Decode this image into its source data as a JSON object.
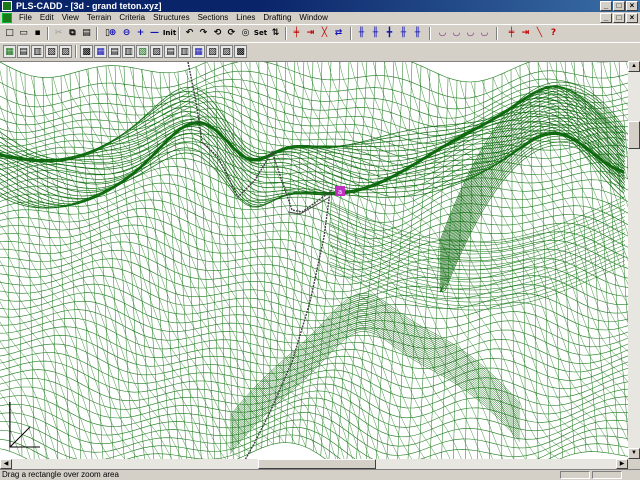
{
  "window": {
    "title": "PLS-CADD - [3d - grand teton.xyz]",
    "minimize_glyph": "_",
    "maximize_glyph": "□",
    "close_glyph": "×"
  },
  "menu": {
    "items": [
      {
        "id": "file",
        "label": "File"
      },
      {
        "id": "edit",
        "label": "Edit"
      },
      {
        "id": "view",
        "label": "View"
      },
      {
        "id": "terrain",
        "label": "Terrain"
      },
      {
        "id": "criteria",
        "label": "Criteria"
      },
      {
        "id": "structures",
        "label": "Structures"
      },
      {
        "id": "sections",
        "label": "Sections"
      },
      {
        "id": "lines",
        "label": "Lines"
      },
      {
        "id": "drafting",
        "label": "Drafting"
      },
      {
        "id": "window",
        "label": "Window"
      }
    ]
  },
  "toolbar": {
    "init_label": "Init",
    "set_label": "Set",
    "icons": [
      "new-icon",
      "open-icon",
      "save-icon",
      "cut-icon",
      "copy-icon",
      "paste-icon",
      "undo-icon",
      "print-icon",
      "help-icon",
      "zoom-in-icon",
      "zoom-out-icon",
      "pan-icon",
      "full-extent-icon",
      "rotate-left-icon",
      "rotate-right-icon",
      "rotate-up-icon",
      "rotate-down-icon",
      "structure-add-icon",
      "structure-move-icon",
      "structure-delete-icon",
      "section-icon",
      "string-icon",
      "sag-icon"
    ]
  },
  "colors": {
    "mesh": "#1a7a1a",
    "mesh_dense": "#0f6a0f",
    "alignment_line": "#404040",
    "structure_marker": "#c030c0",
    "title_bar": "#0a246a"
  },
  "status": {
    "message": "Drag a rectangle over zoom area"
  }
}
